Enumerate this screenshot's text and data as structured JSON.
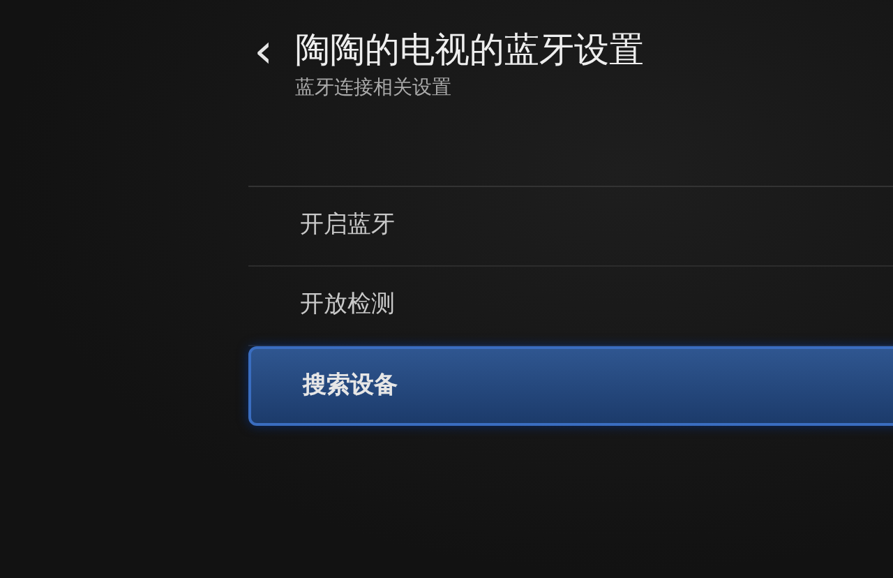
{
  "header": {
    "back": "‹",
    "title": "陶陶的电视的蓝牙设置",
    "subtitle": "蓝牙连接相关设置"
  },
  "items": [
    {
      "label": "开启蓝牙",
      "selected": false
    },
    {
      "label": "开放检测",
      "selected": false
    },
    {
      "label": "搜索设备",
      "selected": true
    }
  ]
}
